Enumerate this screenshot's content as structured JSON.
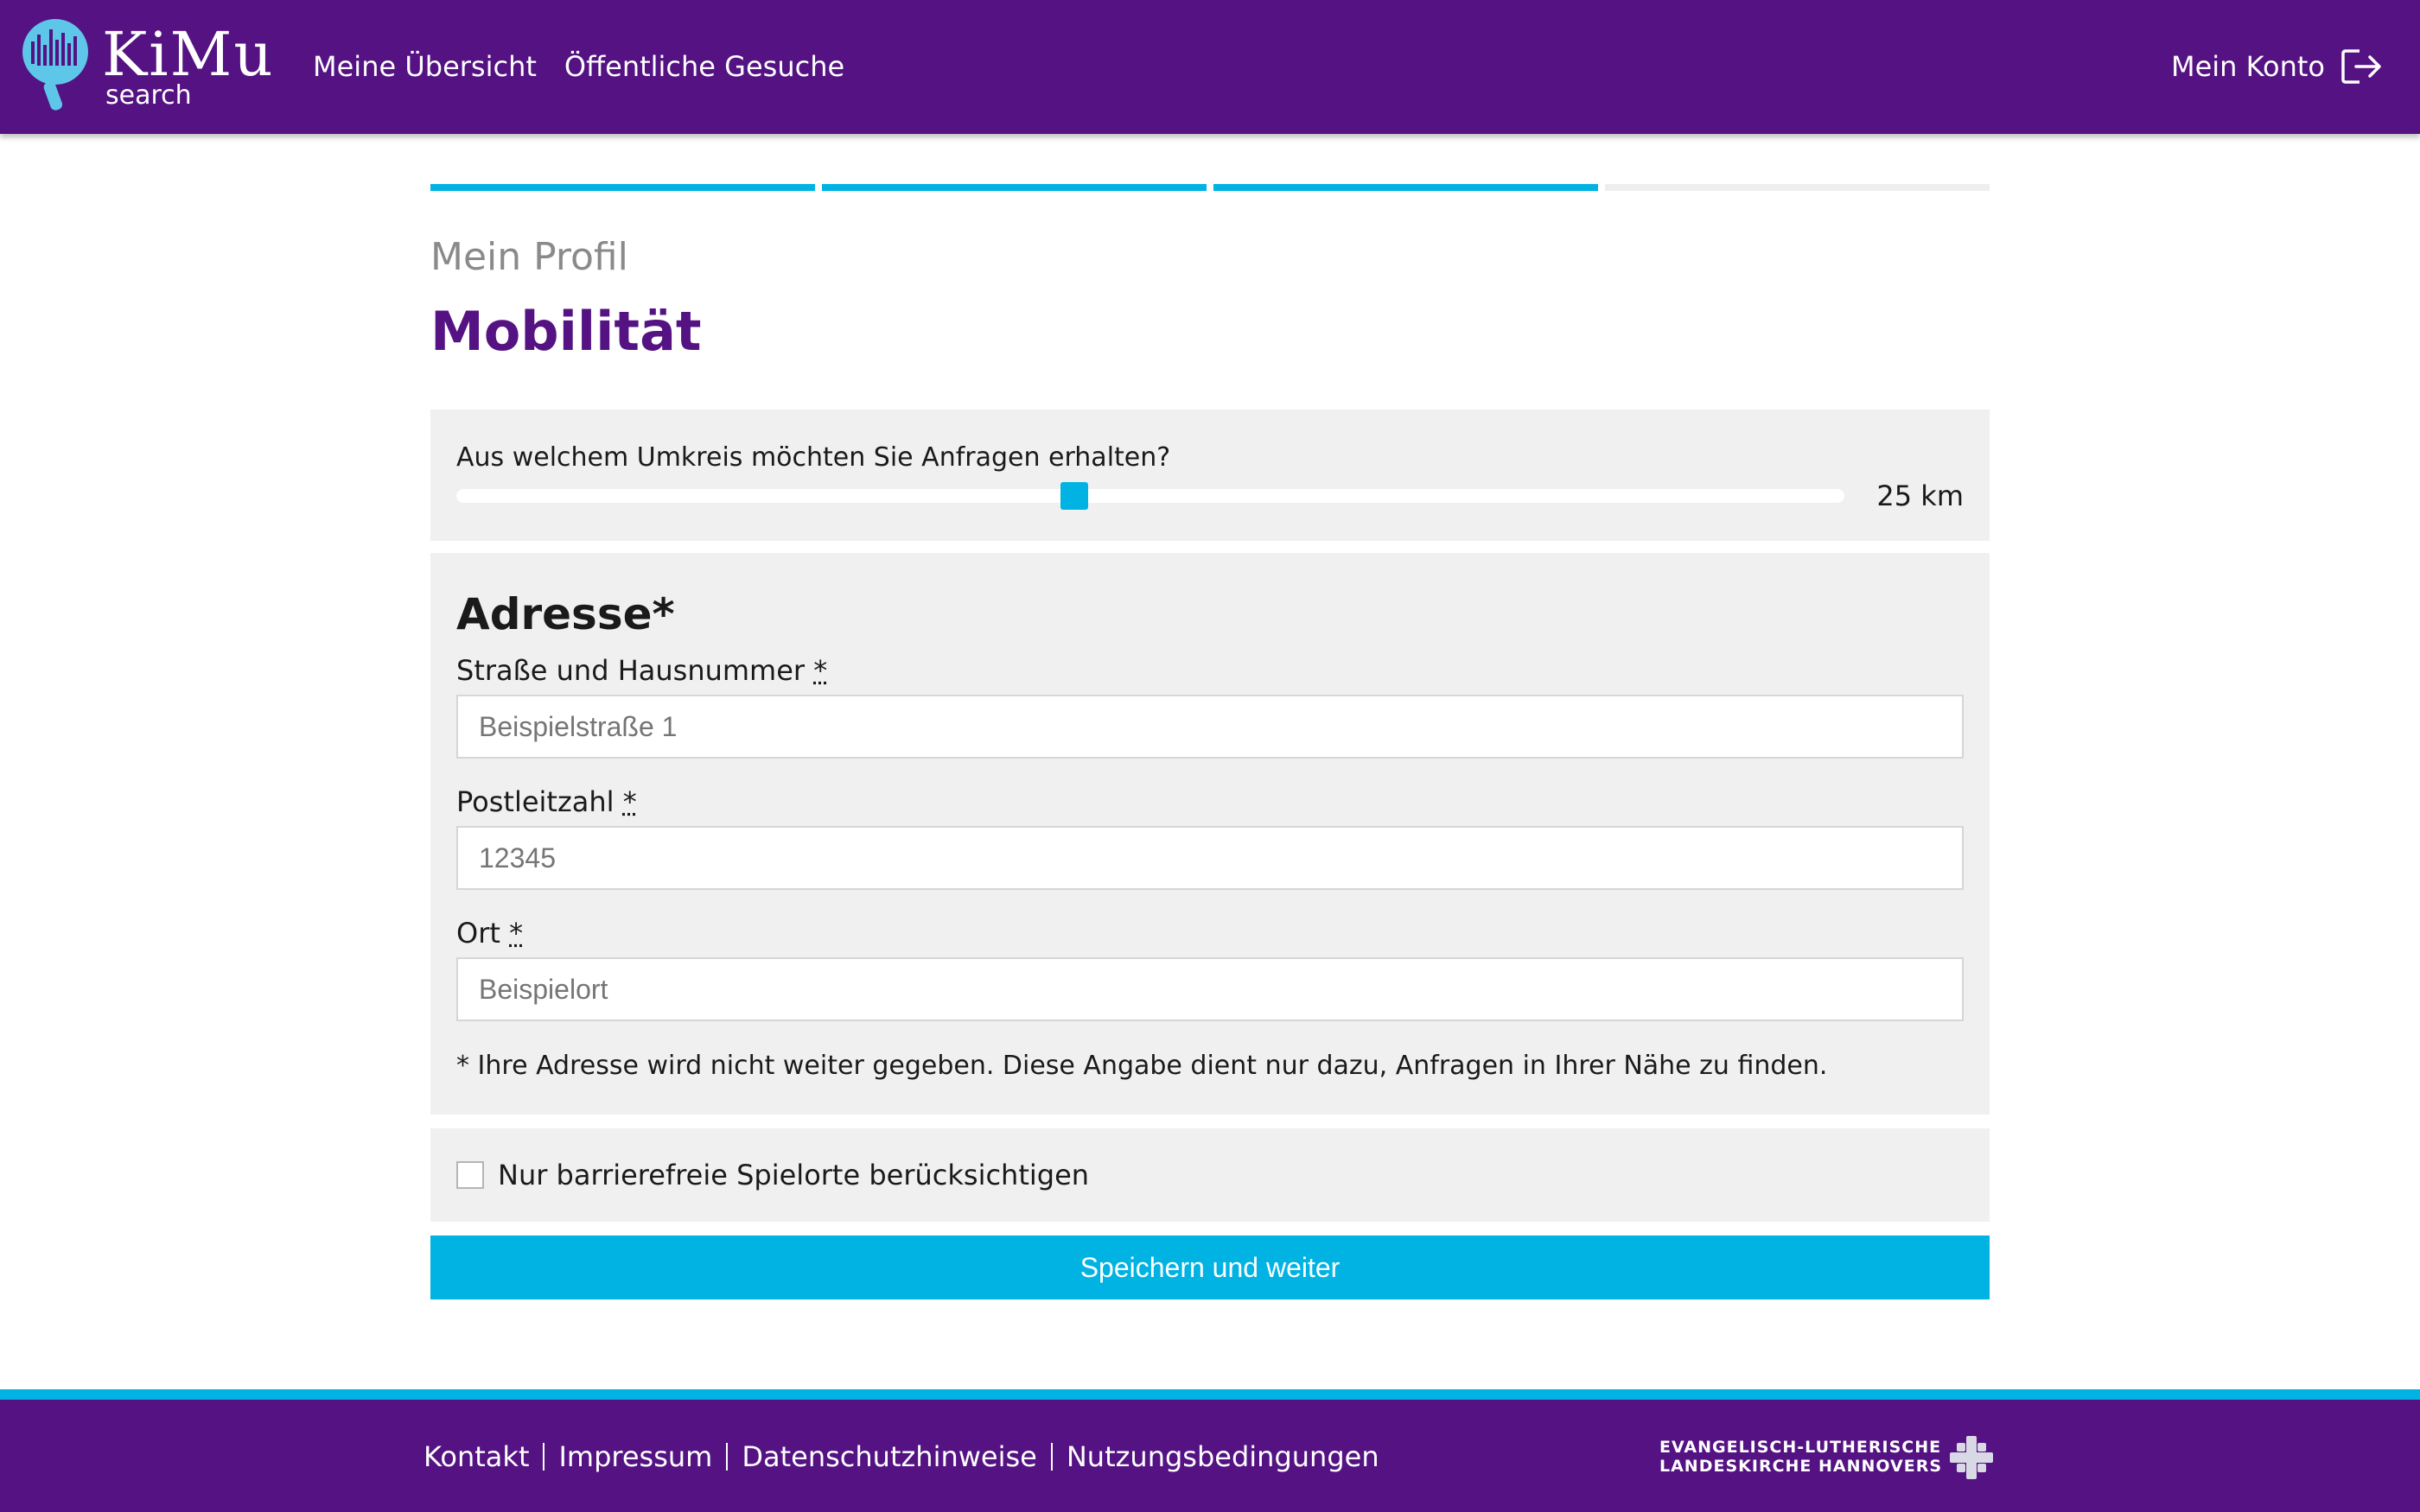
{
  "header": {
    "logo_text": "KiMu",
    "logo_sub": "search",
    "nav": [
      {
        "label": "Meine Übersicht"
      },
      {
        "label": "Öffentliche Gesuche"
      }
    ],
    "account_label": "Mein Konto"
  },
  "progress": {
    "steps_total": 4,
    "steps_completed": 3
  },
  "page": {
    "pre_title": "Mein Profil",
    "title": "Mobilität"
  },
  "radius": {
    "question": "Aus welchem Umkreis möchten Sie Anfragen erhalten?",
    "value_label": "25 km",
    "slider_fraction": 0.445
  },
  "address": {
    "heading": "Adresse*",
    "street_label": "Straße und Hausnummer",
    "street_placeholder": "Beispielstraße 1",
    "zip_label": "Postleitzahl",
    "zip_placeholder": "12345",
    "city_label": "Ort",
    "city_placeholder": "Beispielort",
    "required_mark": "*",
    "note": "* Ihre Adresse wird nicht weiter gegeben. Diese Angabe dient nur dazu, Anfragen in Ihrer Nähe zu finden."
  },
  "accessibility": {
    "label": "Nur barrierefreie Spielorte berücksichtigen",
    "checked": false
  },
  "submit_label": "Speichern und weiter",
  "footer": {
    "links": [
      {
        "label": "Kontakt"
      },
      {
        "label": "Impressum"
      },
      {
        "label": "Datenschutzhinweise"
      },
      {
        "label": "Nutzungsbedingungen"
      }
    ],
    "church_line1": "EVANGELISCH-LUTHERISCHE",
    "church_line2": "LANDESKIRCHE HANNOVERS"
  },
  "colors": {
    "brand": "#541283",
    "accent": "#00b3e3",
    "panel": "#f0f0f0"
  }
}
